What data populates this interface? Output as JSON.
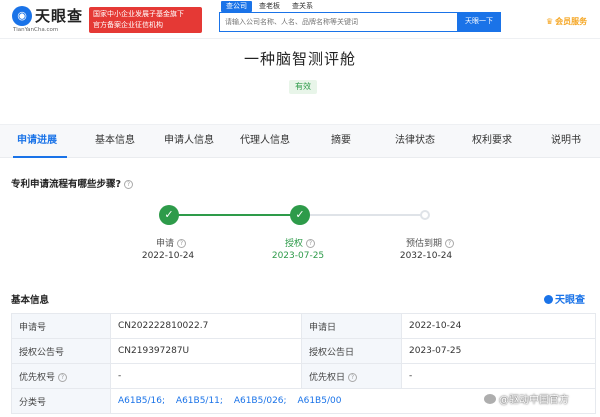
{
  "header": {
    "logo_text": "天眼查",
    "logo_url": "TianYanCha.com",
    "badge_line1": "国家中小企业发展子基金旗下",
    "badge_line2": "官方备案企业征信机构",
    "nav_tabs": [
      "查公司",
      "查老板",
      "查关系"
    ],
    "search_placeholder": "请输入公司名称、人名、品牌名称等关键词",
    "search_button": "天眼一下",
    "member_label": "会员服务"
  },
  "patent": {
    "title": "一种脑智测评舱",
    "status": "有效"
  },
  "tabs": [
    "申请进展",
    "基本信息",
    "申请人信息",
    "代理人信息",
    "摘要",
    "法律状态",
    "权利要求",
    "说明书"
  ],
  "progress": {
    "title": "专利申请流程有哪些步骤?",
    "steps": [
      {
        "label": "申请",
        "date": "2022-10-24",
        "done": true
      },
      {
        "label": "授权",
        "date": "2023-07-25",
        "done": true
      },
      {
        "label": "预估到期",
        "date": "2032-10-24",
        "done": false
      }
    ]
  },
  "basic_info": {
    "title": "基本信息",
    "brand": "天眼查",
    "rows": [
      {
        "k1": "申请号",
        "v1": "CN202222810022.7",
        "k2": "申请日",
        "v2": "2022-10-24"
      },
      {
        "k1": "授权公告号",
        "v1": "CN219397287U",
        "k2": "授权公告日",
        "v2": "2023-07-25"
      },
      {
        "k1": "优先权号",
        "v1": "-",
        "k2": "优先权日",
        "v2": "-"
      }
    ],
    "classification_key": "分类号",
    "classifications": [
      "A61B5/16;",
      "A61B5/11;",
      "A61B5/026;",
      "A61B5/00"
    ]
  },
  "watermark": "@驱动中国官方",
  "colors": {
    "primary": "#1a73e8",
    "success": "#2e9b4a",
    "badge_red": "#e53935",
    "member_gold": "#f5a623"
  }
}
